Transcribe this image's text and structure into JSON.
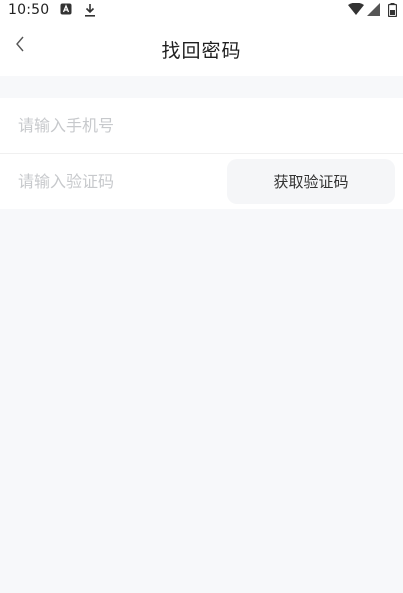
{
  "status_bar": {
    "time": "10:50",
    "left_icons": [
      "a-badge-icon",
      "download-icon"
    ],
    "right_icons": [
      "wifi-icon",
      "signal-icon",
      "battery-icon"
    ]
  },
  "app_bar": {
    "title": "找回密码",
    "back_icon": "chevron-left-icon"
  },
  "form": {
    "phone": {
      "placeholder": "请输入手机号",
      "value": ""
    },
    "code": {
      "placeholder": "请输入验证码",
      "value": ""
    },
    "get_code_label": "获取验证码"
  },
  "colors": {
    "page_bg": "#f7f8fa",
    "placeholder": "#c7c9cc",
    "button_bg": "#f5f6f8"
  }
}
